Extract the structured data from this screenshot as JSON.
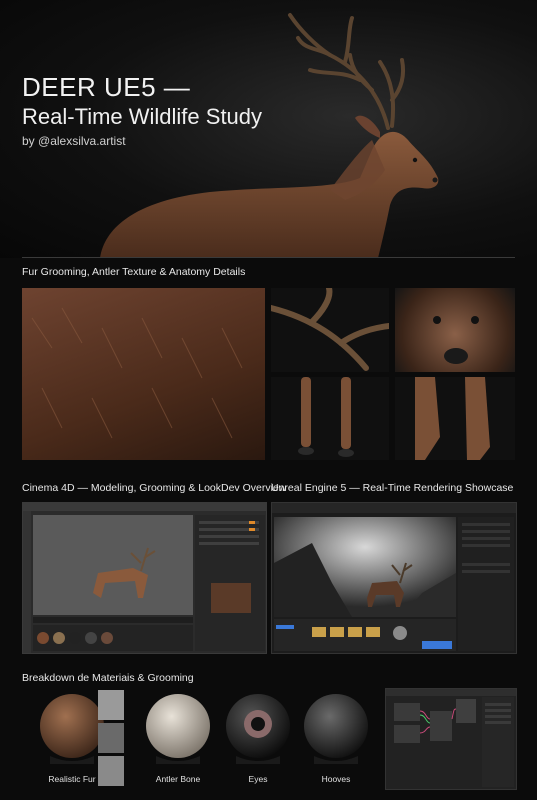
{
  "header": {
    "title": "DEER UE5 —",
    "subtitle": "Real-Time Wildlife Study",
    "byline": "by @alexsilva.artist"
  },
  "sections": {
    "details": "Fur Grooming, Antler Texture & Anatomy Details",
    "cinema": "Cinema 4D — Modeling, Grooming & LookDev Overview",
    "unreal": "Unreal Engine 5 — Real-Time Rendering Showcase",
    "breakdown": "Breakdown de Materiais & Grooming"
  },
  "materials": [
    {
      "label": "Realistic Fur"
    },
    {
      "label": "Antler Bone"
    },
    {
      "label": "Eyes"
    },
    {
      "label": "Hooves"
    }
  ],
  "colors": {
    "background": "#0b0b0b",
    "fur": "#7a4a30",
    "antler": "#5a4430",
    "ui_dark": "#2b2b2b",
    "ue_accent": "#3a78d8"
  }
}
